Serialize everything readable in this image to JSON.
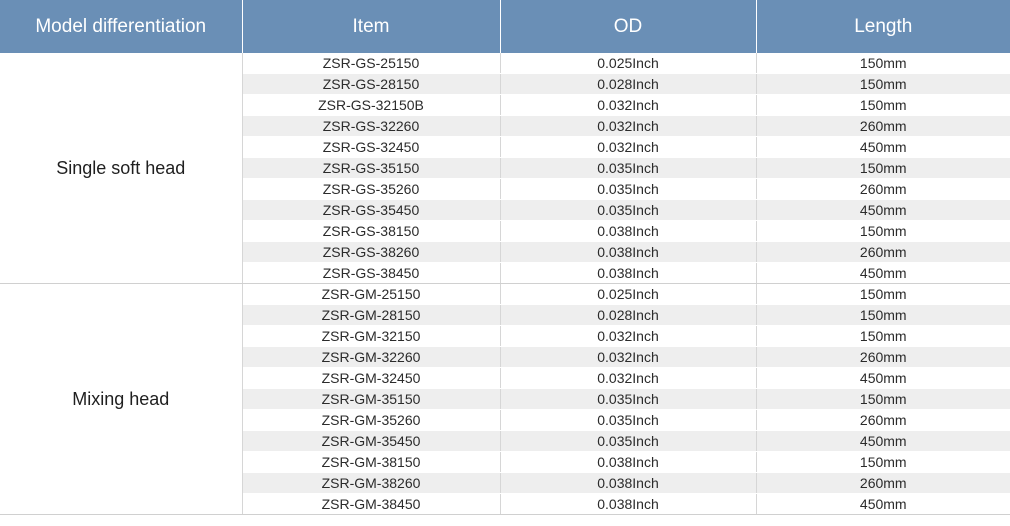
{
  "headers": [
    "Model differentiation",
    "Item",
    "OD",
    "Length"
  ],
  "groups": [
    {
      "name": "Single soft head",
      "rows": [
        [
          "ZSR-GS-25150",
          "0.025Inch",
          "150mm"
        ],
        [
          "ZSR-GS-28150",
          "0.028Inch",
          "150mm"
        ],
        [
          "ZSR-GS-32150B",
          "0.032Inch",
          "150mm"
        ],
        [
          "ZSR-GS-32260",
          "0.032Inch",
          "260mm"
        ],
        [
          "ZSR-GS-32450",
          "0.032Inch",
          "450mm"
        ],
        [
          "ZSR-GS-35150",
          "0.035Inch",
          "150mm"
        ],
        [
          "ZSR-GS-35260",
          "0.035Inch",
          "260mm"
        ],
        [
          "ZSR-GS-35450",
          "0.035Inch",
          "450mm"
        ],
        [
          "ZSR-GS-38150",
          "0.038Inch",
          "150mm"
        ],
        [
          "ZSR-GS-38260",
          "0.038Inch",
          "260mm"
        ],
        [
          "ZSR-GS-38450",
          "0.038Inch",
          "450mm"
        ]
      ]
    },
    {
      "name": "Mixing head",
      "rows": [
        [
          "ZSR-GM-25150",
          "0.025Inch",
          "150mm"
        ],
        [
          "ZSR-GM-28150",
          "0.028Inch",
          "150mm"
        ],
        [
          "ZSR-GM-32150",
          "0.032Inch",
          "150mm"
        ],
        [
          "ZSR-GM-32260",
          "0.032Inch",
          "260mm"
        ],
        [
          "ZSR-GM-32450",
          "0.032Inch",
          "450mm"
        ],
        [
          "ZSR-GM-35150",
          "0.035Inch",
          "150mm"
        ],
        [
          "ZSR-GM-35260",
          "0.035Inch",
          "260mm"
        ],
        [
          "ZSR-GM-35450",
          "0.035Inch",
          "450mm"
        ],
        [
          "ZSR-GM-38150",
          "0.038Inch",
          "150mm"
        ],
        [
          "ZSR-GM-38260",
          "0.038Inch",
          "260mm"
        ],
        [
          "ZSR-GM-38450",
          "0.038Inch",
          "450mm"
        ]
      ]
    }
  ],
  "colors": {
    "header_bg": "#6a8fb6",
    "header_text": "#ffffff",
    "stripe": "#eeeeee"
  }
}
